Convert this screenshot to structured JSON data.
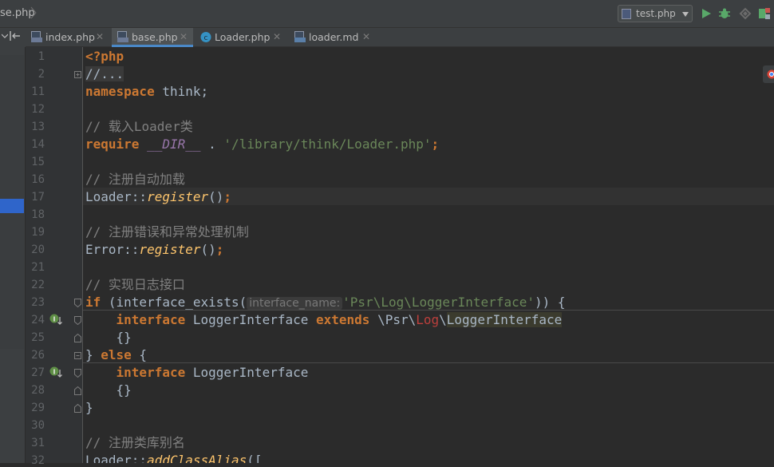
{
  "breadcrumb": {
    "file": "se.php"
  },
  "toolbar": {
    "run_config_label": "test.php",
    "buttons": [
      "run-icon",
      "debug-icon",
      "coverage-icon",
      "profile-icon"
    ]
  },
  "tabs": [
    {
      "label": "index.php",
      "icon": "php-file-icon",
      "active": false
    },
    {
      "label": "base.php",
      "icon": "php-file-icon",
      "active": true
    },
    {
      "label": "Loader.php",
      "icon": "php-class-icon",
      "active": false
    },
    {
      "label": "loader.md",
      "icon": "markdown-file-icon",
      "active": false
    }
  ],
  "code": {
    "lines": [
      {
        "n": "1",
        "tokens": [
          {
            "t": "<?php",
            "c": "tk-php"
          }
        ]
      },
      {
        "n": "2",
        "tokens": [
          {
            "t": "//...",
            "c": "tk-fold"
          }
        ]
      },
      {
        "n": "11",
        "tokens": [
          {
            "t": "namespace",
            "c": "tk-kw"
          },
          {
            "t": " think;",
            "c": "tk-plain"
          }
        ]
      },
      {
        "n": "12",
        "tokens": []
      },
      {
        "n": "13",
        "tokens": [
          {
            "t": "// 载入Loader类",
            "c": "tk-cm"
          }
        ]
      },
      {
        "n": "14",
        "tokens": [
          {
            "t": "require",
            "c": "tk-kw"
          },
          {
            "t": " ",
            "c": "tk-plain"
          },
          {
            "t": "__DIR__",
            "c": "tk-const"
          },
          {
            "t": " . ",
            "c": "tk-plain"
          },
          {
            "t": "'/library/think/Loader.php'",
            "c": "tk-str"
          },
          {
            "t": ";",
            "c": "tk-kw"
          }
        ]
      },
      {
        "n": "15",
        "tokens": []
      },
      {
        "n": "16",
        "tokens": [
          {
            "t": "// 注册自动加载",
            "c": "tk-cm"
          }
        ]
      },
      {
        "n": "17",
        "tokens": [
          {
            "t": "Loader::",
            "c": "tk-plain"
          },
          {
            "t": "register",
            "c": "tk-fn"
          },
          {
            "t": "()",
            "c": "tk-plain"
          },
          {
            "t": ";",
            "c": "tk-kw"
          }
        ]
      },
      {
        "n": "18",
        "tokens": []
      },
      {
        "n": "19",
        "tokens": [
          {
            "t": "// 注册错误和异常处理机制",
            "c": "tk-cm"
          }
        ]
      },
      {
        "n": "20",
        "tokens": [
          {
            "t": "Error::",
            "c": "tk-plain"
          },
          {
            "t": "register",
            "c": "tk-fn"
          },
          {
            "t": "()",
            "c": "tk-plain"
          },
          {
            "t": ";",
            "c": "tk-kw"
          }
        ]
      },
      {
        "n": "21",
        "tokens": []
      },
      {
        "n": "22",
        "tokens": [
          {
            "t": "// 实现日志接口",
            "c": "tk-cm"
          }
        ]
      },
      {
        "n": "23",
        "tokens": [
          {
            "t": "if",
            "c": "tk-kw"
          },
          {
            "t": " (interface_exists(",
            "c": "tk-plain"
          },
          {
            "t": "interface_name:",
            "c": "tk-hint"
          },
          {
            "t": "'Psr\\Log\\LoggerInterface'",
            "c": "tk-str"
          },
          {
            "t": ")) {",
            "c": "tk-plain"
          }
        ]
      },
      {
        "n": "24",
        "tokens": [
          {
            "t": "    ",
            "c": "tk-plain"
          },
          {
            "t": "interface",
            "c": "tk-kw"
          },
          {
            "t": " LoggerInterface ",
            "c": "tk-plain"
          },
          {
            "t": "extends",
            "c": "tk-kw"
          },
          {
            "t": " \\Psr\\",
            "c": "tk-plain"
          },
          {
            "t": "Log",
            "c": "tk-ns-err"
          },
          {
            "t": "\\",
            "c": "tk-plain"
          },
          {
            "t": "LoggerInterface",
            "c": "tk-ns-hl"
          }
        ]
      },
      {
        "n": "25",
        "tokens": [
          {
            "t": "    {}",
            "c": "tk-plain"
          }
        ]
      },
      {
        "n": "26",
        "tokens": [
          {
            "t": "} ",
            "c": "tk-plain"
          },
          {
            "t": "else",
            "c": "tk-kw"
          },
          {
            "t": " {",
            "c": "tk-plain"
          }
        ]
      },
      {
        "n": "27",
        "tokens": [
          {
            "t": "    ",
            "c": "tk-plain"
          },
          {
            "t": "interface",
            "c": "tk-kw"
          },
          {
            "t": " LoggerInterface",
            "c": "tk-plain"
          }
        ]
      },
      {
        "n": "28",
        "tokens": [
          {
            "t": "    {}",
            "c": "tk-plain"
          }
        ]
      },
      {
        "n": "29",
        "tokens": [
          {
            "t": "}",
            "c": "tk-plain"
          }
        ]
      },
      {
        "n": "30",
        "tokens": []
      },
      {
        "n": "31",
        "tokens": [
          {
            "t": "// 注册类库别名",
            "c": "tk-cm"
          }
        ]
      },
      {
        "n": "32",
        "tokens": [
          {
            "t": "Loader::",
            "c": "tk-plain"
          },
          {
            "t": "addClassAlias",
            "c": "tk-fn"
          },
          {
            "t": "([",
            "c": "tk-plain"
          }
        ]
      }
    ]
  },
  "colors": {
    "background": "#2b2b2b",
    "keyword": "#cc7832",
    "comment": "#808080",
    "string": "#6a8759",
    "function": "#ffc66d",
    "constant": "#9876aa",
    "text": "#a9b7c6",
    "active_tab_underline": "#4a88c7"
  }
}
